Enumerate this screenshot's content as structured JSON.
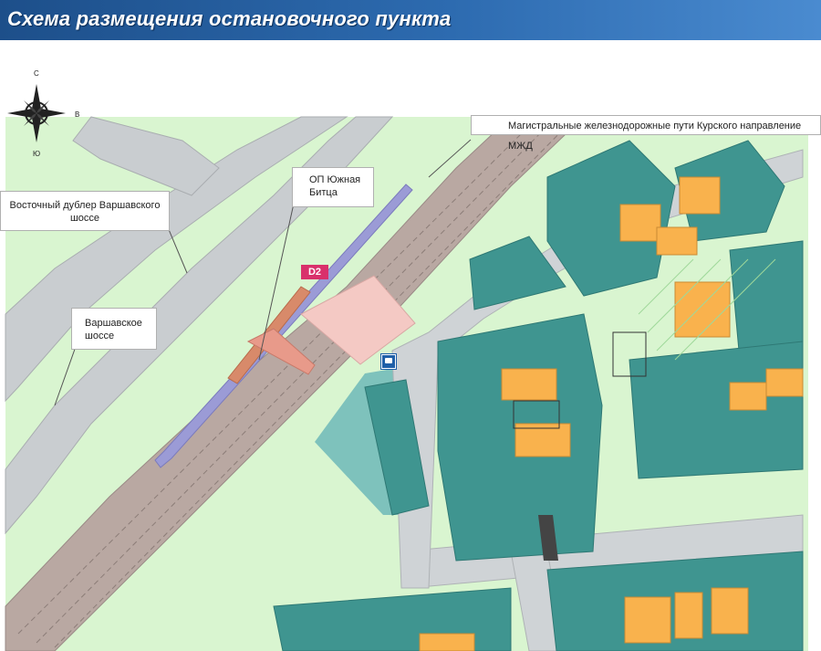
{
  "header": {
    "title": "Схема размещения остановочного пункта"
  },
  "compass": {
    "north": "С",
    "south": "Ю",
    "east": "В"
  },
  "callouts": {
    "rail": "Магистральные железнодорожные пути Курского направление МЖД",
    "dubler": "Восточный дублер Варшавского шоссе",
    "station": "ОП Южная Битца",
    "highway": "Варшавское шоссе"
  },
  "badge": {
    "line": "D2"
  },
  "colors": {
    "greenery": "#d9f5d0",
    "railway": "#b5a39e",
    "platform": "#9b9bd6",
    "road": "#cfd3d6",
    "building": "#3f9590",
    "courtyard": "#f9b24d",
    "header": "#2d6bb0"
  }
}
